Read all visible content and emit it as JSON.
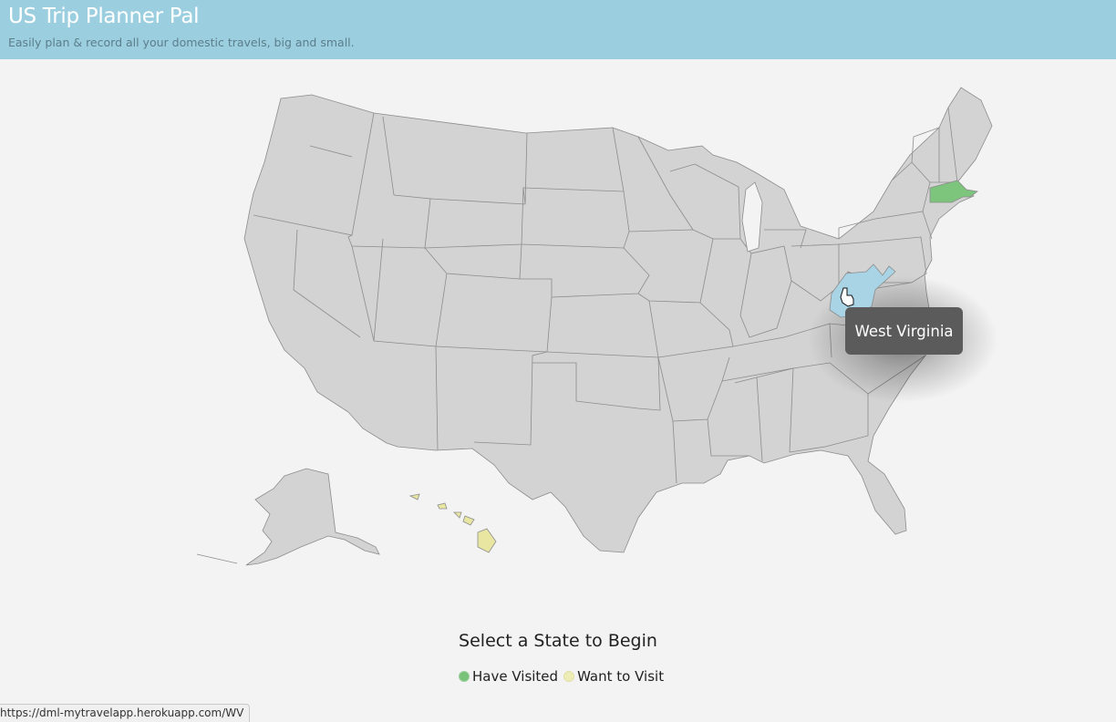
{
  "header": {
    "title": "US Trip Planner Pal",
    "subtitle": "Easily plan & record all your domestic travels, big and small."
  },
  "map": {
    "tooltip": "West Virginia",
    "states": {
      "visited": [
        "Massachusetts"
      ],
      "want_to_visit": [
        "Hawaii"
      ],
      "hovered": "West Virginia"
    },
    "colors": {
      "default": "#d3d3d3",
      "visited": "#7dc47d",
      "want_to_visit": "#e9e6a2",
      "hovered": "#a8d4e6",
      "border": "#8c8c8c"
    }
  },
  "prompt": "Select a State to Begin",
  "legend": {
    "visited_label": "Have Visited",
    "want_label": "Want to Visit"
  },
  "status_bar": {
    "url": "https://dml-mytravelapp.herokuapp.com/WV"
  }
}
